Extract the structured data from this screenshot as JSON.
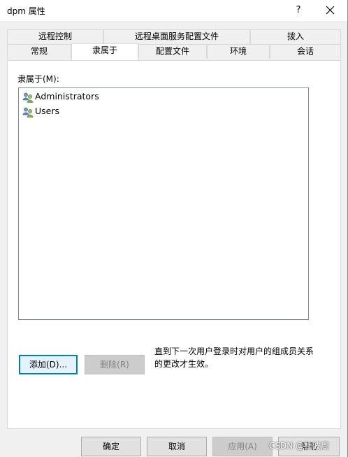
{
  "window": {
    "title": "dpm 属性",
    "help_glyph": "?"
  },
  "tabs": {
    "row_top": [
      {
        "label": "远程控制"
      },
      {
        "label": "远程桌面服务配置文件"
      },
      {
        "label": "拨入"
      }
    ],
    "row_bottom": [
      {
        "label": "常规"
      },
      {
        "label": "隶属于",
        "active": true
      },
      {
        "label": "配置文件"
      },
      {
        "label": "环境"
      },
      {
        "label": "会话"
      }
    ]
  },
  "member_of": {
    "label": "隶属于(M):",
    "items": [
      {
        "name": "Administrators",
        "icon": "group-icon"
      },
      {
        "name": "Users",
        "icon": "group-icon"
      }
    ],
    "add_button": "添加(D)...",
    "remove_button": "删除(R)",
    "note": "直到下一次用户登录时对用户的组成员关系的更改才生效。"
  },
  "footer": {
    "ok": "确定",
    "cancel": "取消",
    "apply": "应用(A)",
    "help": "帮助"
  },
  "watermark": "CSDN @杜波周"
}
